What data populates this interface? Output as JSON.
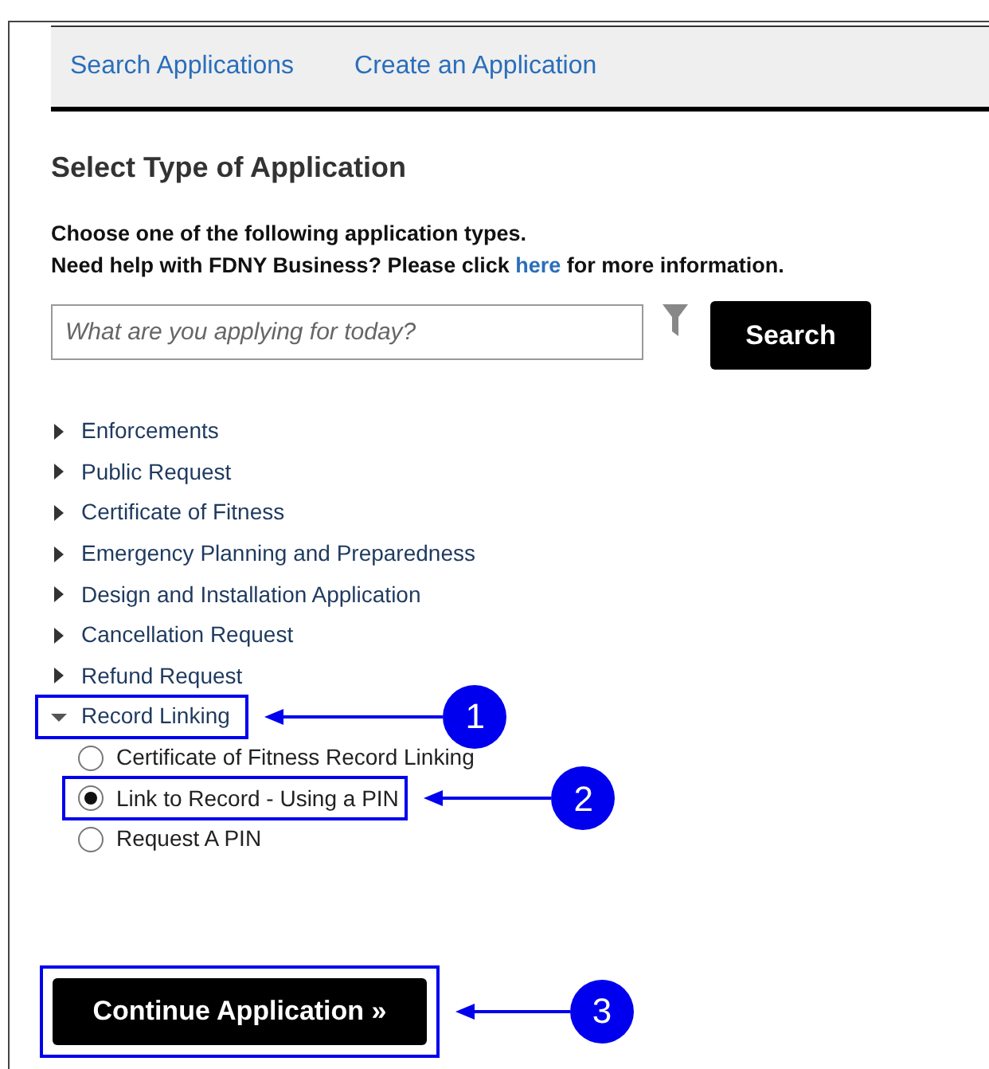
{
  "nav": {
    "tabs": [
      {
        "label": "Search Applications"
      },
      {
        "label": "Create an Application"
      }
    ]
  },
  "heading": "Select Type of Application",
  "intro": {
    "line": "Choose one of the following application types.",
    "help": {
      "before": "Need help with FDNY Business? Please click",
      "link": "here",
      "after": "for more information."
    }
  },
  "search": {
    "placeholder": "What are you applying for today?",
    "button": "Search"
  },
  "tree": [
    {
      "label": "Enforcements",
      "expanded": false
    },
    {
      "label": "Public Request",
      "expanded": false
    },
    {
      "label": "Certificate of Fitness",
      "expanded": false
    },
    {
      "label": "Emergency Planning and Preparedness",
      "expanded": false
    },
    {
      "label": "Design and Installation Application",
      "expanded": false
    },
    {
      "label": "Cancellation Request",
      "expanded": false
    },
    {
      "label": "Refund Request",
      "expanded": false
    },
    {
      "label": "Record Linking",
      "expanded": true,
      "callout": "1",
      "children": [
        {
          "label": "Certificate of Fitness Record Linking",
          "selected": false
        },
        {
          "label": "Link to Record - Using a PIN",
          "selected": true,
          "callout": "2"
        },
        {
          "label": "Request A PIN",
          "selected": false
        }
      ]
    }
  ],
  "continue_button": {
    "label": "Continue Application »",
    "callout": "3"
  }
}
